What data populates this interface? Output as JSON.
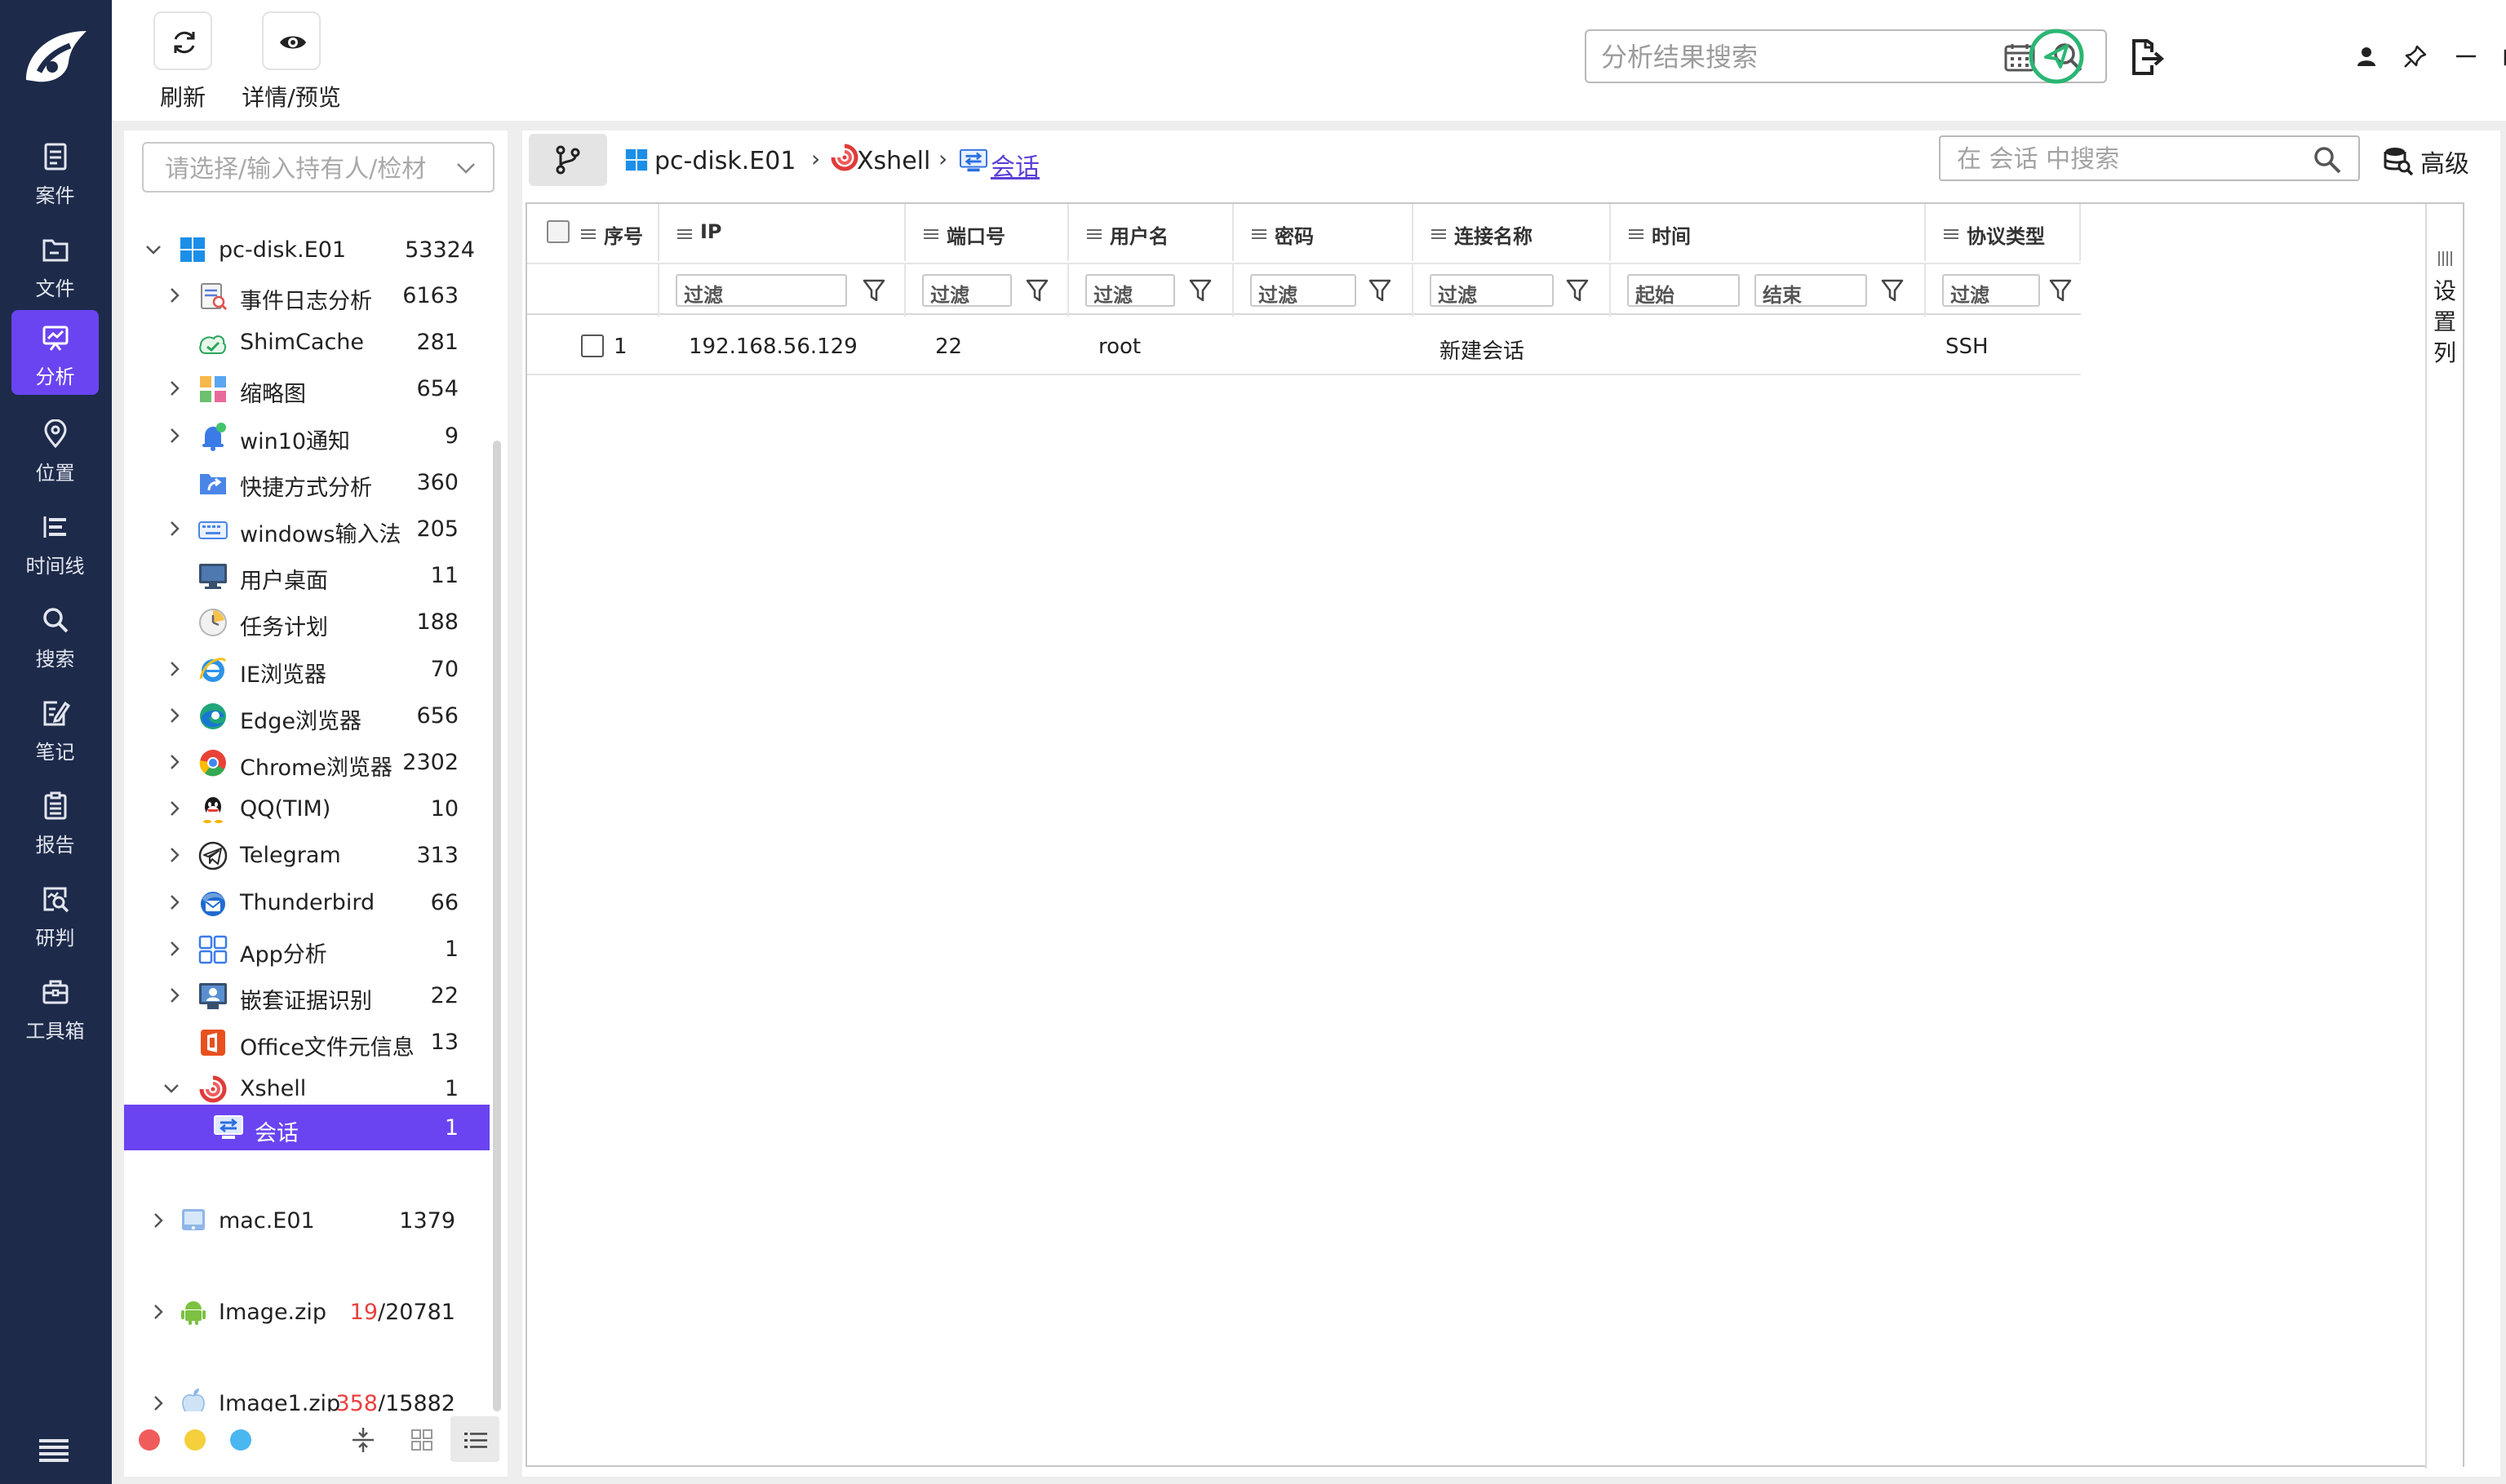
{
  "nav": {
    "items": [
      {
        "label": "案件",
        "icon": "case-icon"
      },
      {
        "label": "文件",
        "icon": "folder-icon"
      },
      {
        "label": "分析",
        "icon": "analysis-icon",
        "active": true
      },
      {
        "label": "位置",
        "icon": "location-pin-icon"
      },
      {
        "label": "时间线",
        "icon": "timeline-icon"
      },
      {
        "label": "搜索",
        "icon": "search-icon"
      },
      {
        "label": "笔记",
        "icon": "note-icon"
      },
      {
        "label": "报告",
        "icon": "report-icon"
      },
      {
        "label": "研判",
        "icon": "judgment-icon"
      },
      {
        "label": "工具箱",
        "icon": "toolbox-icon"
      }
    ]
  },
  "toolbar": {
    "refresh_label": "刷新",
    "detail_label": "详情/预览",
    "search_placeholder": "分析结果搜索"
  },
  "tree": {
    "holder_placeholder": "请选择/输入持有人/检材",
    "root": {
      "label": "pc-disk.E01",
      "count": "53324"
    },
    "items": [
      {
        "label": "事件日志分析",
        "count": "6163",
        "icon": "event-log-icon"
      },
      {
        "label": "ShimCache",
        "count": "281",
        "icon": "shimcache-icon"
      },
      {
        "label": "缩略图",
        "count": "654",
        "icon": "thumbnail-icon"
      },
      {
        "label": "win10通知",
        "count": "9",
        "icon": "notification-bell-icon"
      },
      {
        "label": "快捷方式分析",
        "count": "360",
        "icon": "shortcut-icon"
      },
      {
        "label": "windows输入法",
        "count": "205",
        "icon": "keyboard-icon"
      },
      {
        "label": "用户桌面",
        "count": "11",
        "icon": "desktop-icon"
      },
      {
        "label": "任务计划",
        "count": "188",
        "icon": "clock-icon"
      },
      {
        "label": "IE浏览器",
        "count": "70",
        "icon": "ie-browser-icon"
      },
      {
        "label": "Edge浏览器",
        "count": "656",
        "icon": "edge-browser-icon"
      },
      {
        "label": "Chrome浏览器",
        "count": "2302",
        "icon": "chrome-browser-icon"
      },
      {
        "label": "QQ(TIM)",
        "count": "10",
        "icon": "qq-icon"
      },
      {
        "label": "Telegram",
        "count": "313",
        "icon": "telegram-icon"
      },
      {
        "label": "Thunderbird",
        "count": "66",
        "icon": "thunderbird-icon"
      },
      {
        "label": "App分析",
        "count": "1",
        "icon": "app-grid-icon"
      },
      {
        "label": "嵌套证据识别",
        "count": "22",
        "icon": "nested-evidence-icon"
      },
      {
        "label": "Office文件元信息",
        "count": "13",
        "icon": "office-icon"
      },
      {
        "label": "Xshell",
        "count": "1",
        "icon": "xshell-icon"
      }
    ],
    "selected": {
      "label": "会话",
      "count": "1"
    },
    "sources": [
      {
        "label": "mac.E01",
        "count": "1379"
      },
      {
        "label": "Image.zip",
        "count_red": "19",
        "count_rest": "/20781"
      },
      {
        "label": "Image1.zip",
        "count_red": "358",
        "count_rest": "/15882"
      }
    ]
  },
  "breadcrumb": {
    "disk": "pc-disk.E01",
    "app": "Xshell",
    "current": "会话",
    "separator": "›"
  },
  "table": {
    "search_placeholder": "在 会话 中搜索",
    "advanced_label": "高级",
    "columns": [
      "序号",
      "IP",
      "端口号",
      "用户名",
      "密码",
      "连接名称",
      "时间",
      "协议类型"
    ],
    "filter_placeholder": "过滤",
    "time_start": "起始",
    "time_end": "结束",
    "rows": [
      {
        "index": "1",
        "ip": "192.168.56.129",
        "port": "22",
        "user": "root",
        "password": "",
        "name": "新建会话",
        "time": "",
        "protocol": "SSH"
      }
    ],
    "settings_label": "设置列"
  },
  "colors": {
    "rail_bg": "#1d2a4a",
    "accent": "#6a44f0",
    "count_red": "#e8423f"
  }
}
